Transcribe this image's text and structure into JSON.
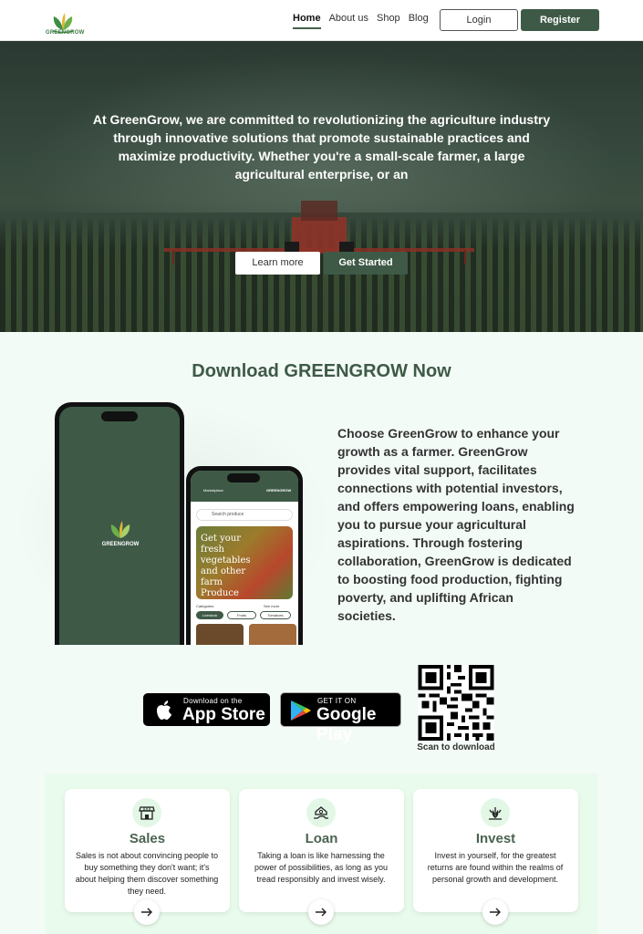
{
  "nav": {
    "logo_text": "GREENGROW",
    "links": [
      "Home",
      "About us",
      "Shop",
      "Blog"
    ],
    "login": "Login",
    "register": "Register"
  },
  "hero": {
    "text": "At GreenGrow, we are committed to revolutionizing the agriculture industry through innovative solutions that promote sustainable practices and maximize productivity. Whether you're a small-scale farmer, a large agricultural enterprise, or an",
    "learn_more": "Learn more",
    "get_started": "Get Started"
  },
  "download": {
    "title": "Download GREENGROW Now",
    "description": "Choose GreenGrow to enhance your growth as a farmer. GreenGrow provides vital support, facilitates connections with potential investors, and offers empowering loans, enabling you to pursue your agricultural aspirations. Through fostering collaboration, GreenGrow is dedicated to boosting food production, fighting poverty, and uplifting African societies.",
    "phone1_logo_text": "GREENGROW",
    "phone2": {
      "header_title": "Marketplace",
      "header_brand": "GREENGROW",
      "search_placeholder": "Search produce",
      "banner_text": "Get your fresh vegetables and other farm Produce",
      "categories_label": "Categories",
      "see_more": "See more",
      "chips": [
        "Livestock",
        "Fruits",
        "Tomatoes"
      ]
    },
    "app_store_small": "Download on the",
    "app_store_big": "App Store",
    "google_small": "GET IT ON",
    "google_big": "Google Play",
    "qr_label": "Scan to download"
  },
  "features": [
    {
      "title": "Sales",
      "description": "Sales is not about convincing people to buy something they don't want; it's about helping them discover something they need.",
      "icon": "shop-icon"
    },
    {
      "title": "Loan",
      "description": "Taking a loan is like harnessing the power of possibilities, as long as you tread responsibly and invest wisely.",
      "icon": "loan-icon"
    },
    {
      "title": "Invest",
      "description": "Invest in yourself, for the greatest returns are found within the realms of personal growth and development.",
      "icon": "invest-icon"
    }
  ],
  "colors": {
    "brand_dark": "#3e5a47",
    "feature_bg": "#e9fbec",
    "accent_light": "#e3f7e6"
  }
}
